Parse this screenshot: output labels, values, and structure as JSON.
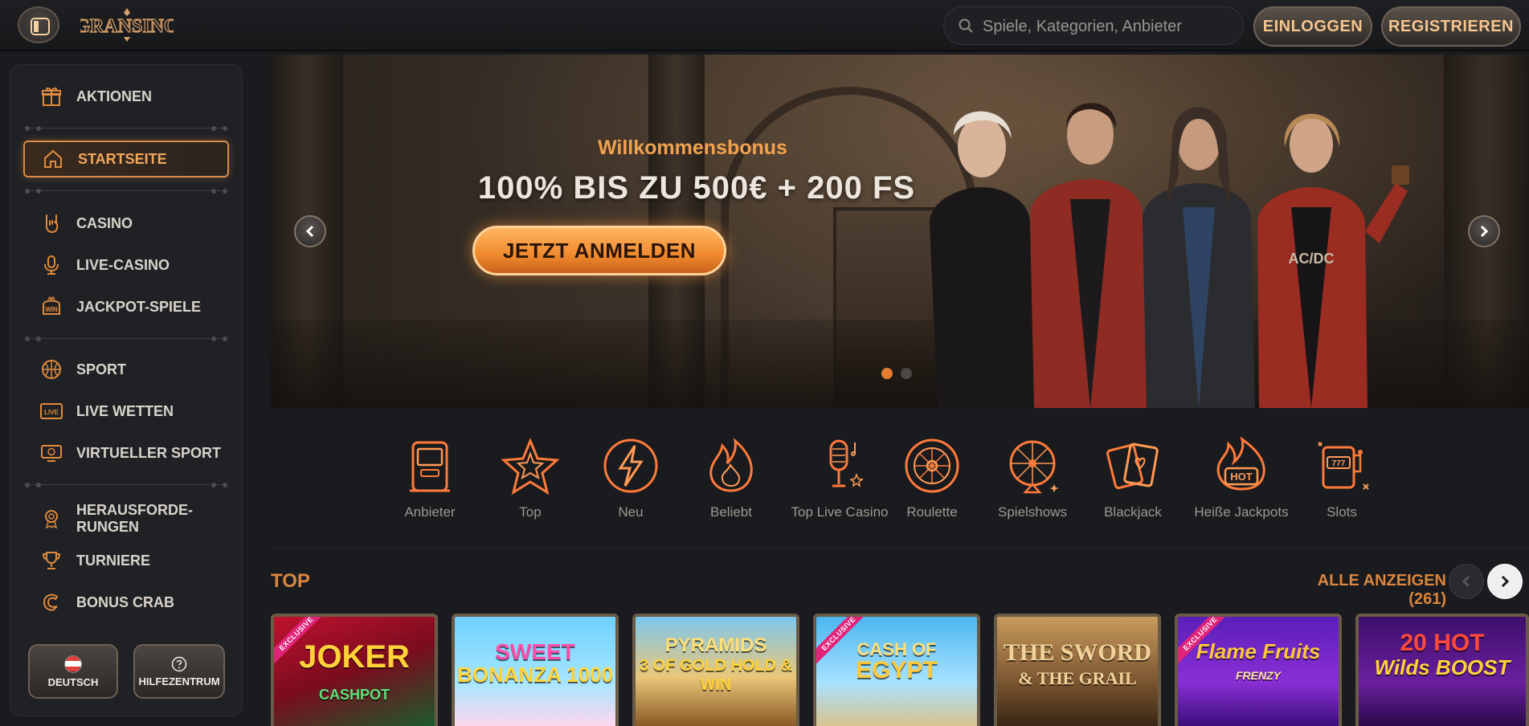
{
  "header": {
    "logo_text": "GRANSINO",
    "search_placeholder": "Spiele, Kategorien, Anbieter",
    "login_label": "EINLOGGEN",
    "register_label": "REGISTRIEREN"
  },
  "sidebar": {
    "items": [
      {
        "label": "AKTIONEN",
        "icon": "gift-icon"
      },
      {
        "label": "STARTSEITE",
        "icon": "home-icon",
        "active": true
      },
      {
        "label": "CASINO",
        "icon": "rock-hand-icon"
      },
      {
        "label": "LIVE-CASINO",
        "icon": "microphone-icon"
      },
      {
        "label": "JACKPOT-SPIELE",
        "icon": "jackpot-win-icon"
      },
      {
        "label": "SPORT",
        "icon": "basketball-icon"
      },
      {
        "label": "LIVE WETTEN",
        "icon": "live-icon"
      },
      {
        "label": "VIRTUELLER SPORT",
        "icon": "virtual-screen-icon"
      },
      {
        "label": "HERAUSFORDE-RUNGEN",
        "label_line1": "HERAUSFORDE-",
        "label_line2": "RUNGEN",
        "icon": "award-ribbon-icon"
      },
      {
        "label": "TURNIERE",
        "icon": "trophy-icon"
      },
      {
        "label": "BONUS CRAB",
        "icon": "crab-claw-icon"
      }
    ],
    "language_label": "DEUTSCH",
    "help_label": "HILFEZENTRUM"
  },
  "banner": {
    "subtitle": "Willkommensbonus",
    "title": "100% BIS ZU 500€ + 200 FS",
    "cta_label": "JETZT ANMELDEN",
    "slides_total": 2,
    "active_slide": 1
  },
  "categories": [
    {
      "label": "Anbieter",
      "icon": "arcade-machine-icon"
    },
    {
      "label": "Top",
      "icon": "star-icon"
    },
    {
      "label": "Neu",
      "icon": "lightning-icon"
    },
    {
      "label": "Beliebt",
      "icon": "flame-icon"
    },
    {
      "label": "Top Live Casino",
      "icon": "microphone-icon"
    },
    {
      "label": "Roulette",
      "icon": "roulette-icon"
    },
    {
      "label": "Spielshows",
      "icon": "wheel-of-fortune-icon"
    },
    {
      "label": "Blackjack",
      "icon": "cards-icon"
    },
    {
      "label": "Heiße Jackpots",
      "icon": "hot-icon"
    },
    {
      "label": "Slots",
      "icon": "slot-machine-icon"
    }
  ],
  "top_section": {
    "title": "TOP",
    "see_all_label": "ALLE ANZEIGEN (261)"
  },
  "games": [
    {
      "title": "JOKER",
      "subtitle": "CASHPOT",
      "exclusive": true,
      "exclusive_label": "EXCLUSIVE"
    },
    {
      "title": "SWEET",
      "subtitle": "BONANZA 1000",
      "exclusive": false
    },
    {
      "title": "PYRAMIDS",
      "subtitle": "3 OF GOLD HOLD & WIN",
      "exclusive": false
    },
    {
      "title": "CASH OF",
      "subtitle": "EGYPT",
      "exclusive": true,
      "exclusive_label": "EXCLUSIVE"
    },
    {
      "title": "THE SWORD",
      "subtitle": "& THE GRAIL",
      "exclusive": false
    },
    {
      "title": "Flame Fruits",
      "subtitle": "FRENZY",
      "exclusive": true,
      "exclusive_label": "EXCLUSIVE"
    },
    {
      "title": "20 HOT",
      "subtitle": "Wilds BOOST",
      "exclusive": false
    }
  ],
  "colors": {
    "accent": "#e08a3c",
    "active_text": "#f3a75a",
    "background": "#1a1b1e",
    "sidebar_bg": "#202124"
  }
}
